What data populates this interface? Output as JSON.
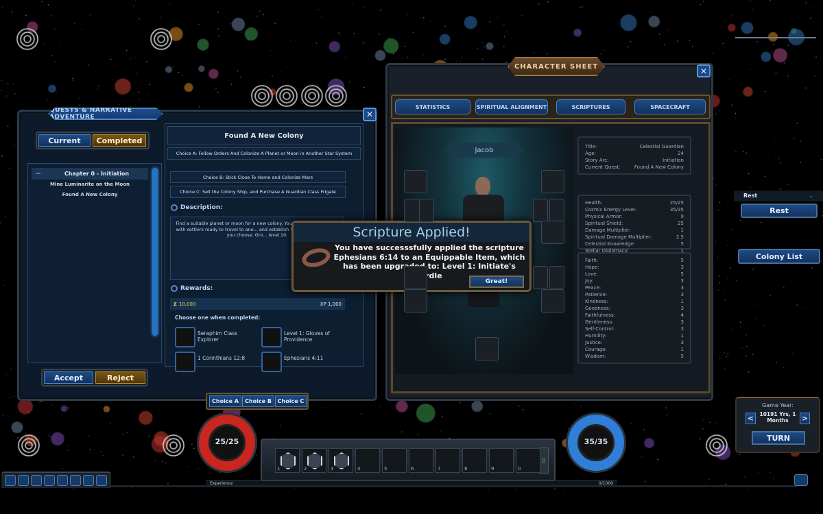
{
  "quests": {
    "title": "QUESTS & NARRATIVE ADVENTURE",
    "close": "✕",
    "tabs": {
      "current": "Current",
      "completed": "Completed"
    },
    "chapter": {
      "toggle": "−",
      "label": "Chapter 0 - Initiation",
      "items": [
        "Mine Luminarite on the Moon",
        "Found A New Colony"
      ]
    },
    "accept": "Accept",
    "reject": "Reject",
    "detail": {
      "title": "Found A New Colony",
      "choice_a": "Choice A: Follow Orders And Colonize A Planet or Moon in Another Star System",
      "choice_b": "Choice B: Stick Close To Home and Colonize Mars",
      "choice_c": "Choice C: Sell the Colony Ship, and Purchase A Guardian Class Frigate",
      "description_label": "Description:",
      "description": "Find a suitable planet or moon for a new colony. You w... of a Colony Ship with settlers ready to travel to ano... and establish themselves wherever you choose. Gro... level 10.",
      "rewards_label": "Rewards:",
      "gold": "10,000",
      "xp": "XP 1,000",
      "choose_label": "Choose one when completed:",
      "reward_items": [
        "Seraphim Class Explorer",
        "Level 1: Gloves of Providence",
        "1 Corinthians 12:8",
        "Ephesians 4:11"
      ]
    },
    "choice_tabs": [
      "Choice A",
      "Choice B",
      "Choice C"
    ]
  },
  "character": {
    "title": "CHARACTER SHEET",
    "close": "✕",
    "tabs": [
      "STATISTICS",
      "SPIRITUAL ALIGNMENT",
      "SCRIPTURES",
      "SPACECRAFT"
    ],
    "name": "Jacob",
    "info": [
      [
        "Title:",
        "Celestial Guardian"
      ],
      [
        "Age:",
        "24"
      ],
      [
        "Story Arc:",
        "Initiation"
      ],
      [
        "Current Quest:",
        "Found A New Colony"
      ]
    ],
    "stats": [
      [
        "Health:",
        "25/25"
      ],
      [
        "Cosmic Energy Level:",
        "35/35"
      ],
      [
        "Physical Armor:",
        "0"
      ],
      [
        "Spiritual Shield:",
        "25"
      ],
      [
        "Damage Multiplier:",
        "1"
      ],
      [
        "Spiritual Damage Multiplier:",
        "2.5"
      ],
      [
        "Celestial Knowledge:",
        "5"
      ],
      [
        "Stellar Diplomacy:",
        "1"
      ],
      [
        "Void Corruption:",
        "0"
      ],
      [
        "Intimacy With God:",
        "0"
      ]
    ],
    "virtues": [
      [
        "Faith:",
        "5"
      ],
      [
        "Hope:",
        "3"
      ],
      [
        "Love:",
        "5"
      ],
      [
        "Joy:",
        "3"
      ],
      [
        "Peace:",
        "3"
      ],
      [
        "Patience:",
        "3"
      ],
      [
        "Kindness:",
        "1"
      ],
      [
        "Goodness:",
        "3"
      ],
      [
        "Faithfulness:",
        "4"
      ],
      [
        "Gentleness:",
        "3"
      ],
      [
        "Self-Control:",
        "3"
      ],
      [
        "Humility:",
        "1"
      ],
      [
        "Justice:",
        "3"
      ],
      [
        "Courage:",
        "1"
      ],
      [
        "Wisdom:",
        "5"
      ]
    ],
    "colors": {
      "void_corruption": "#e0564f",
      "intimacy": "#6fd04a"
    }
  },
  "popup": {
    "title": "Scripture Applied!",
    "message": "You have successsfully applied the scripture Ephesians 6:14 to an Equippable Item, which has been upgraded to: Level 1: Initiate's Girdle",
    "button": "Great!"
  },
  "right": {
    "dropdown": "Rest",
    "rest_button": "Rest",
    "colony_button": "Colony List",
    "game_year_label": "Game Year:",
    "game_year": "10191 Yrs, 1 Months",
    "prev": "<",
    "next": ">",
    "turn": "TURN"
  },
  "hud": {
    "health": "25/25",
    "energy": "35/35",
    "slots": [
      "1",
      "2",
      "3",
      "4",
      "5",
      "6",
      "7",
      "8",
      "9",
      "0"
    ],
    "slot_icons": [
      "target-hex-icon",
      "rocket-hex-icon",
      "move-hex-icon"
    ],
    "page": "0",
    "experience_label": "Experience",
    "experience": "0/1000",
    "experience_fraction": 0
  },
  "toolbar_icons": [
    "character-icon",
    "inventory-icon",
    "skills-icon",
    "journal-icon",
    "map-icon",
    "ship-icon",
    "settings-icon",
    "chat-icon"
  ]
}
